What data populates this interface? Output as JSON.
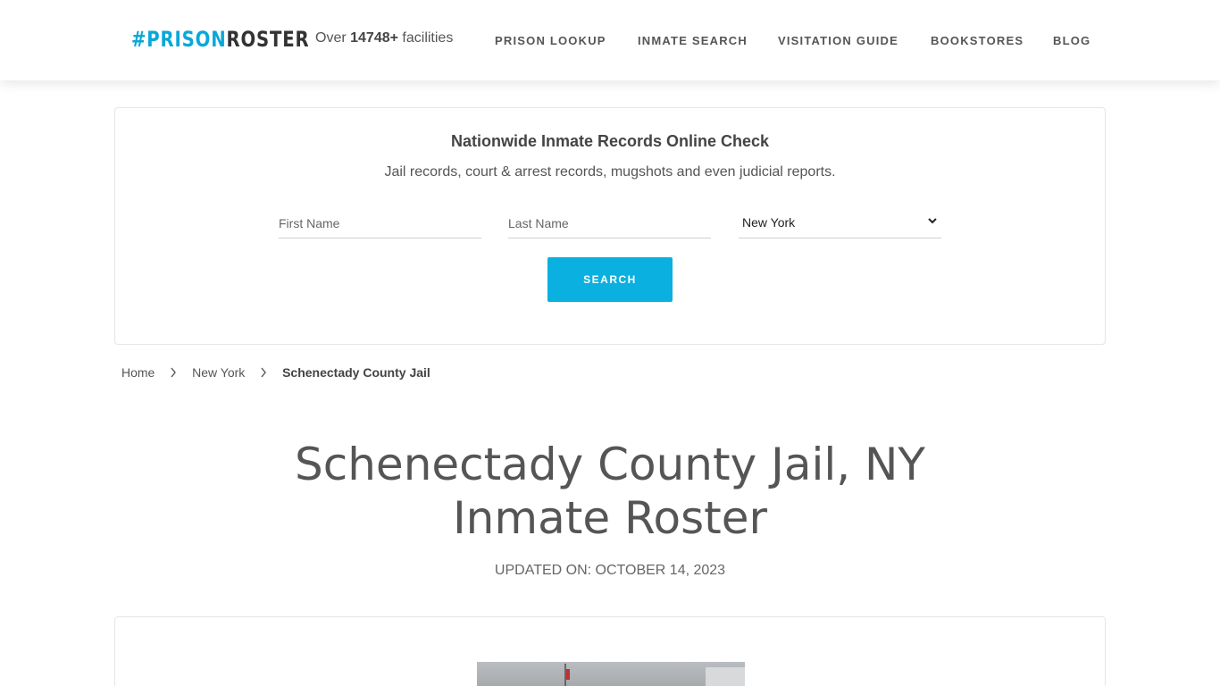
{
  "header": {
    "logo": {
      "hash": "#",
      "prison": "PRISON",
      "roster": "ROSTER"
    },
    "facilities_prefix": "Over ",
    "facilities_count": "14748+",
    "facilities_suffix": " facilities",
    "nav": [
      {
        "label": "PRISON LOOKUP"
      },
      {
        "label": "INMATE SEARCH"
      },
      {
        "label": "VISITATION GUIDE"
      },
      {
        "label": "BOOKSTORES"
      },
      {
        "label": "BLOG"
      }
    ]
  },
  "search": {
    "title": "Nationwide Inmate Records Online Check",
    "subtitle": "Jail records, court & arrest records, mugshots and even judicial reports.",
    "first_name_placeholder": "First Name",
    "last_name_placeholder": "Last Name",
    "state_selected": "New York",
    "button_label": "SEARCH"
  },
  "breadcrumb": {
    "home": "Home",
    "state": "New York",
    "current": "Schenectady County Jail"
  },
  "page": {
    "title_line1": "Schenectady County Jail, NY",
    "title_line2": "Inmate Roster",
    "updated": "UPDATED ON: OCTOBER 14, 2023"
  },
  "colors": {
    "accent": "#0ab0e0",
    "logo_dark": "#333333"
  }
}
